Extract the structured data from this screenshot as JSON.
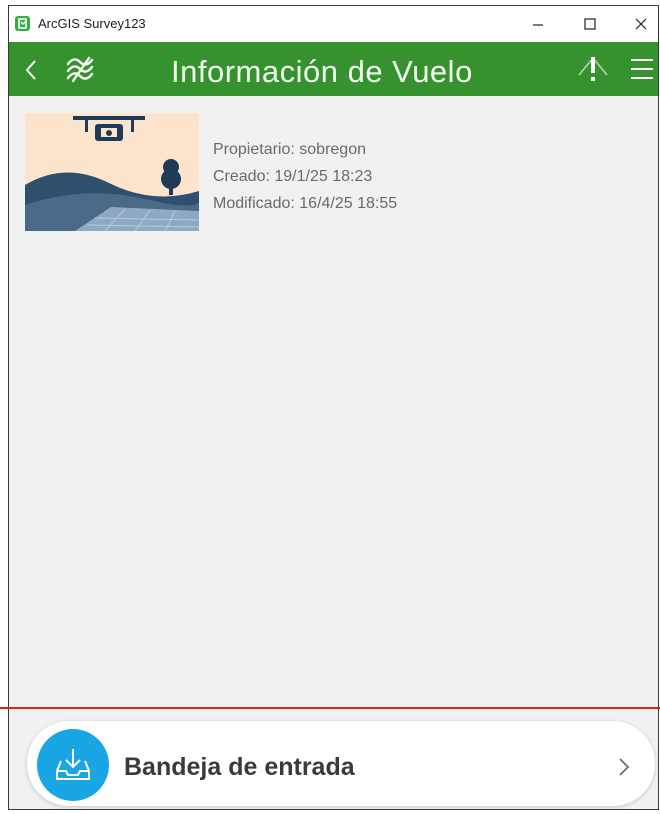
{
  "window": {
    "title": "ArcGIS Survey123",
    "app_icon": "survey123-logo-icon",
    "controls": [
      "minimize-icon",
      "maximize-icon",
      "close-icon"
    ]
  },
  "header": {
    "title": "Información de Vuelo",
    "left_icons": [
      "back-arrow-icon",
      "sync-icon"
    ],
    "right_icons": [
      "location-alert-icon",
      "hamburger-menu-icon"
    ],
    "background_color": "#35922f"
  },
  "survey": {
    "thumbnail_icon": "drone-landscape-thumbnail",
    "owner": "Propietario: sobregon",
    "created": "Creado: 19/1/25 18:23",
    "modified": "Modificado: 16/4/25 18:55"
  },
  "inbox": {
    "label": "Bandeja de entrada",
    "icon": "inbox-download-icon",
    "accent_color": "#1aa6e4",
    "chevron": "chevron-right-icon"
  }
}
